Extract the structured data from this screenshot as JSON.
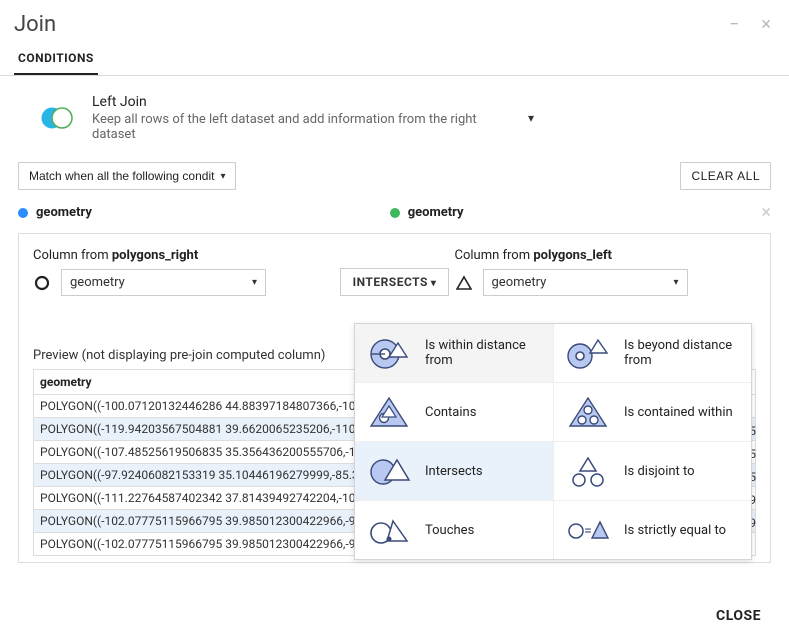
{
  "header": {
    "title": "Join"
  },
  "tabs": {
    "conditions": "CONDITIONS"
  },
  "join_type": {
    "title": "Left Join",
    "desc": "Keep all rows of the left dataset and add information from the right dataset"
  },
  "toolbar": {
    "match_mode": "Match when all the following condit",
    "clear_all": "CLEAR ALL"
  },
  "cond_header": {
    "left_name": "geometry",
    "right_name": "geometry"
  },
  "pickers": {
    "left_label_prefix": "Column from ",
    "left_dataset": "polygons_right",
    "left_column": "geometry",
    "right_label_prefix": "Column from ",
    "right_dataset": "polygons_left",
    "right_column": "geometry",
    "operator": "INTERSECTS"
  },
  "dropdown": {
    "items": [
      {
        "key": "within_distance",
        "label": "Is within distance from"
      },
      {
        "key": "beyond_distance",
        "label": "Is beyond distance from"
      },
      {
        "key": "contains",
        "label": "Contains"
      },
      {
        "key": "contained_within",
        "label": "Is contained within"
      },
      {
        "key": "intersects",
        "label": "Intersects"
      },
      {
        "key": "disjoint",
        "label": "Is disjoint to"
      },
      {
        "key": "touches",
        "label": "Touches"
      },
      {
        "key": "strictly_equal",
        "label": "Is strictly equal to"
      }
    ],
    "highlighted": "within_distance",
    "selected": "intersects"
  },
  "preview": {
    "label": "Preview (not displaying pre-join computed column)",
    "column_header": "geometry",
    "rows": [
      "POLYGON((-100.07120132446286 44.88397184807366,-108.",
      "POLYGON((-119.94203567504881 39.6620065235206,-110.9",
      "POLYGON((-107.48525619506835 35.356436200555706,-107",
      "POLYGON((-97.92406082153319 35.10446196279999,-85.37",
      "POLYGON((-111.22764587402342 37.81439492742204,-108.",
      "POLYGON((-102.07775115966795 39.985012300422966,-95.",
      "POLYGON((-102.07775115966795 39.985012300422966,-95.4239"
    ],
    "right_values": [
      "5",
      "5",
      "5",
      "9",
      "9"
    ]
  },
  "footer": {
    "close": "CLOSE"
  }
}
